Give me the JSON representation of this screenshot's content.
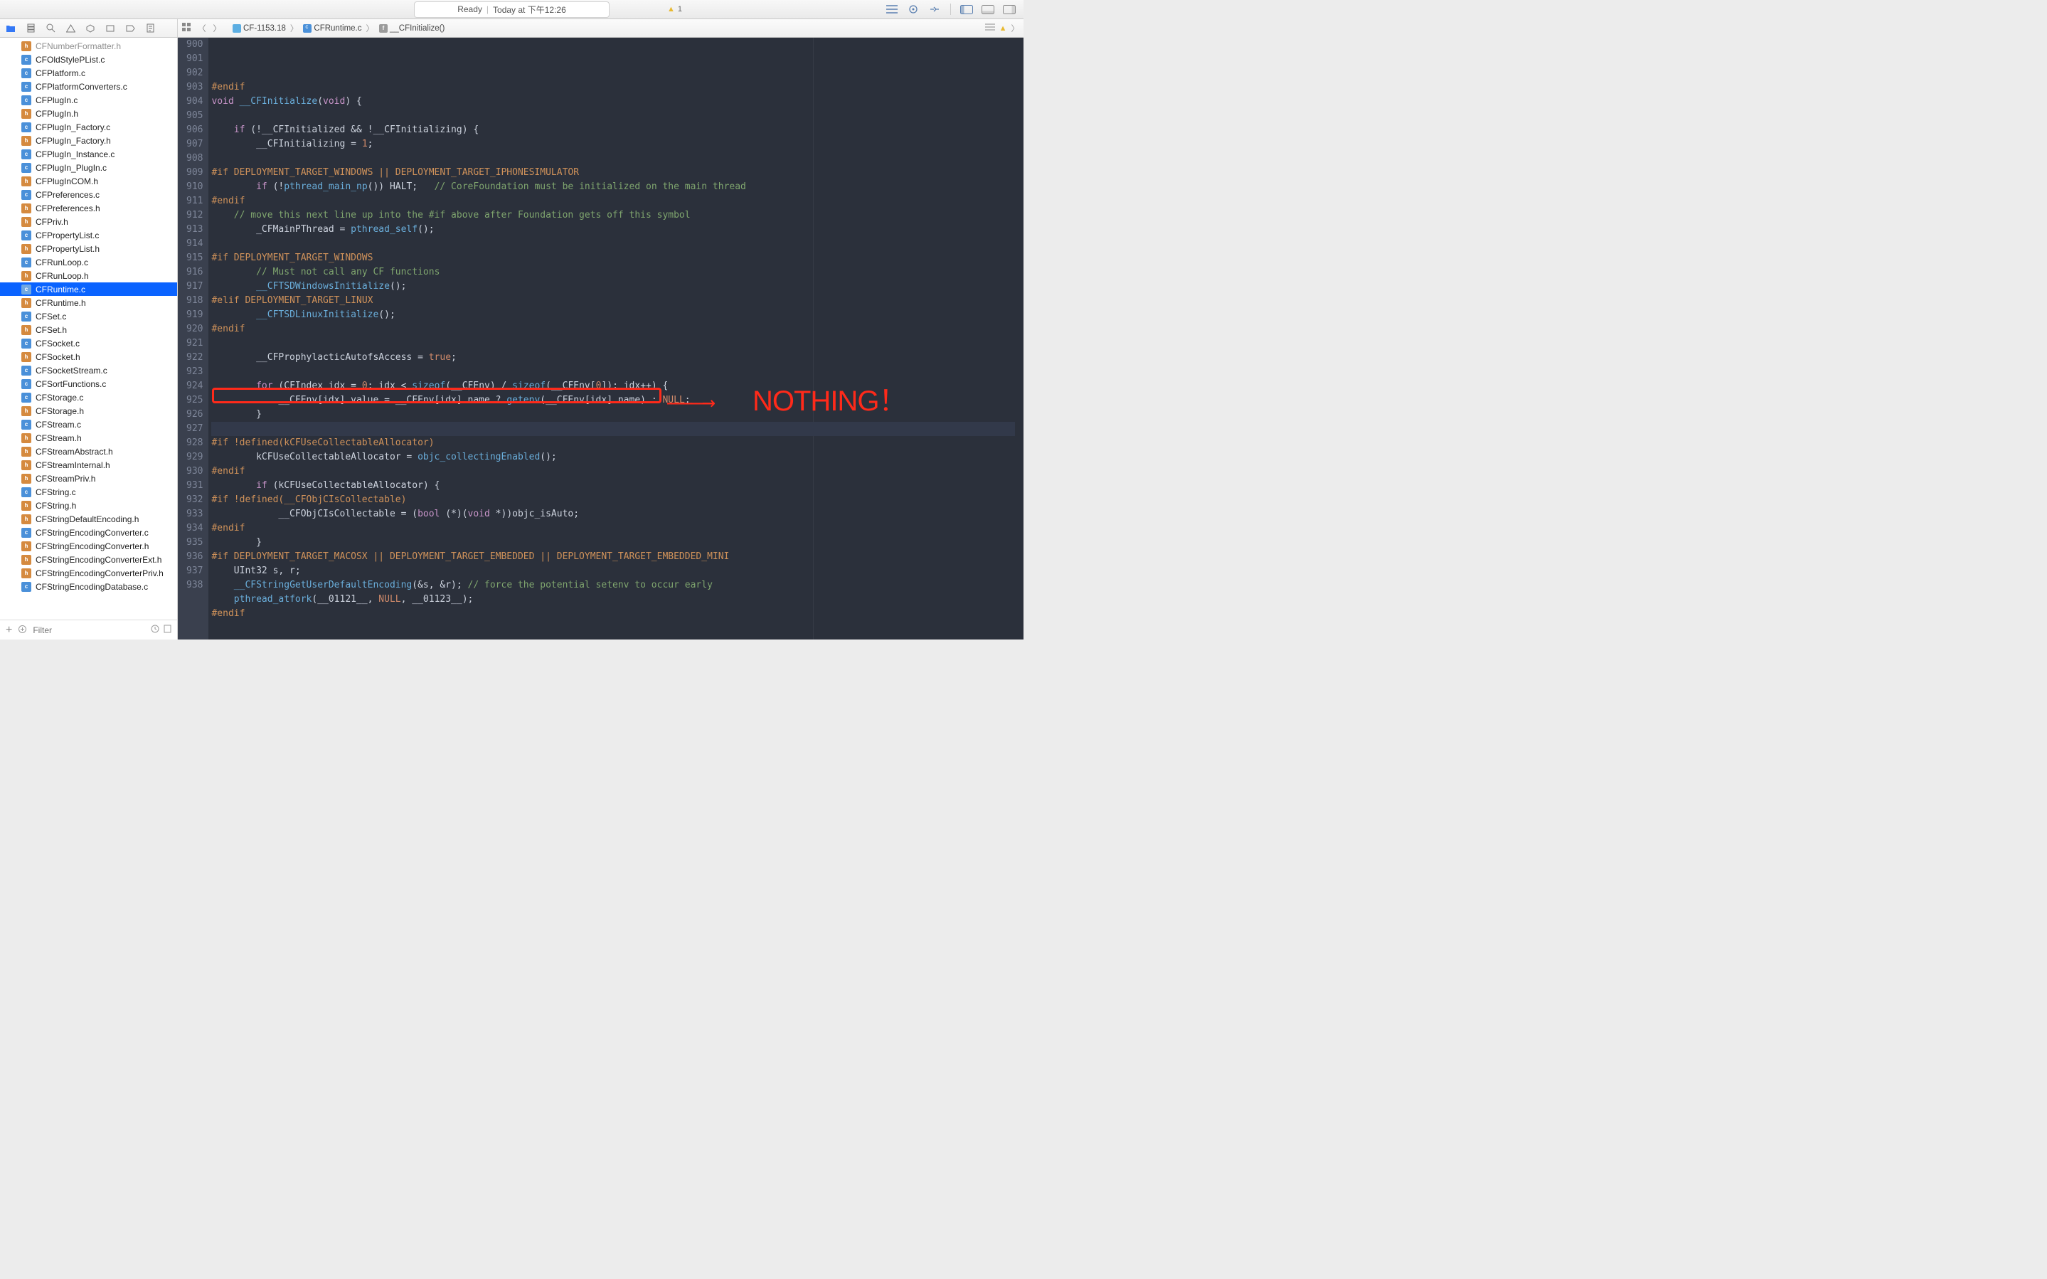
{
  "status_bar": {
    "status": "Ready",
    "timestamp": "Today at 下午12:26",
    "warning_count": "1"
  },
  "breadcrumb": {
    "project": "CF-1153.18",
    "file": "CFRuntime.c",
    "symbol": "__CFInitialize()"
  },
  "sidebar_filter_placeholder": "Filter",
  "files": [
    {
      "name": "CFNumberFormatter.h",
      "type": "h",
      "cut": true
    },
    {
      "name": "CFOldStylePList.c",
      "type": "c"
    },
    {
      "name": "CFPlatform.c",
      "type": "c"
    },
    {
      "name": "CFPlatformConverters.c",
      "type": "c"
    },
    {
      "name": "CFPlugIn.c",
      "type": "c"
    },
    {
      "name": "CFPlugIn.h",
      "type": "h"
    },
    {
      "name": "CFPlugIn_Factory.c",
      "type": "c"
    },
    {
      "name": "CFPlugIn_Factory.h",
      "type": "h"
    },
    {
      "name": "CFPlugIn_Instance.c",
      "type": "c"
    },
    {
      "name": "CFPlugIn_PlugIn.c",
      "type": "c"
    },
    {
      "name": "CFPlugInCOM.h",
      "type": "h"
    },
    {
      "name": "CFPreferences.c",
      "type": "c"
    },
    {
      "name": "CFPreferences.h",
      "type": "h"
    },
    {
      "name": "CFPriv.h",
      "type": "h"
    },
    {
      "name": "CFPropertyList.c",
      "type": "c"
    },
    {
      "name": "CFPropertyList.h",
      "type": "h"
    },
    {
      "name": "CFRunLoop.c",
      "type": "c"
    },
    {
      "name": "CFRunLoop.h",
      "type": "h"
    },
    {
      "name": "CFRuntime.c",
      "type": "c",
      "selected": true
    },
    {
      "name": "CFRuntime.h",
      "type": "h"
    },
    {
      "name": "CFSet.c",
      "type": "c"
    },
    {
      "name": "CFSet.h",
      "type": "h"
    },
    {
      "name": "CFSocket.c",
      "type": "c"
    },
    {
      "name": "CFSocket.h",
      "type": "h"
    },
    {
      "name": "CFSocketStream.c",
      "type": "c"
    },
    {
      "name": "CFSortFunctions.c",
      "type": "c"
    },
    {
      "name": "CFStorage.c",
      "type": "c"
    },
    {
      "name": "CFStorage.h",
      "type": "h"
    },
    {
      "name": "CFStream.c",
      "type": "c"
    },
    {
      "name": "CFStream.h",
      "type": "h"
    },
    {
      "name": "CFStreamAbstract.h",
      "type": "h"
    },
    {
      "name": "CFStreamInternal.h",
      "type": "h"
    },
    {
      "name": "CFStreamPriv.h",
      "type": "h"
    },
    {
      "name": "CFString.c",
      "type": "c"
    },
    {
      "name": "CFString.h",
      "type": "h"
    },
    {
      "name": "CFStringDefaultEncoding.h",
      "type": "h"
    },
    {
      "name": "CFStringEncodingConverter.c",
      "type": "c"
    },
    {
      "name": "CFStringEncodingConverter.h",
      "type": "h"
    },
    {
      "name": "CFStringEncodingConverterExt.h",
      "type": "h"
    },
    {
      "name": "CFStringEncodingConverterPriv.h",
      "type": "h"
    },
    {
      "name": "CFStringEncodingDatabase.c",
      "type": "c"
    }
  ],
  "annotation": {
    "arrow": "———→",
    "label": "NOTHING！"
  },
  "gutter_start": 900,
  "gutter_end": 938,
  "current_line": 924,
  "code_lines": [
    {
      "n": 900,
      "html": "<span class='pp'>#endif</span>"
    },
    {
      "n": 901,
      "html": "<span class='kw'>void</span> <span class='fn'>__CFInitialize</span>(<span class='kw'>void</span>) {"
    },
    {
      "n": 902,
      "html": ""
    },
    {
      "n": 903,
      "html": "    <span class='kw'>if</span> (!__CFInitialized &amp;&amp; !__CFInitializing) {"
    },
    {
      "n": 904,
      "html": "        __CFInitializing = <span class='num'>1</span>;"
    },
    {
      "n": 905,
      "html": ""
    },
    {
      "n": 906,
      "html": "<span class='pp'>#if</span> <span class='pparg'>DEPLOYMENT_TARGET_WINDOWS || DEPLOYMENT_TARGET_IPHONESIMULATOR</span>"
    },
    {
      "n": 907,
      "html": "        <span class='kw'>if</span> (!<span class='fn'>pthread_main_np</span>()) HALT;   <span class='cm'>// CoreFoundation must be initialized on the main thread</span>"
    },
    {
      "n": 908,
      "html": "<span class='pp'>#endif</span>"
    },
    {
      "n": 909,
      "html": "    <span class='cm'>// move this next line up into the #if above after Foundation gets off this symbol</span>"
    },
    {
      "n": 910,
      "html": "        _CFMainPThread = <span class='fn'>pthread_self</span>();"
    },
    {
      "n": 911,
      "html": ""
    },
    {
      "n": 912,
      "html": "<span class='pp'>#if</span> <span class='pparg'>DEPLOYMENT_TARGET_WINDOWS</span>"
    },
    {
      "n": 913,
      "html": "        <span class='cm'>// Must not call any CF functions</span>"
    },
    {
      "n": 914,
      "html": "        <span class='fn'>__CFTSDWindowsInitialize</span>();"
    },
    {
      "n": 915,
      "html": "<span class='pp'>#elif</span> <span class='pparg'>DEPLOYMENT_TARGET_LINUX</span>"
    },
    {
      "n": 916,
      "html": "        <span class='fn'>__CFTSDLinuxInitialize</span>();"
    },
    {
      "n": 917,
      "html": "<span class='pp'>#endif</span>"
    },
    {
      "n": 918,
      "html": ""
    },
    {
      "n": 919,
      "html": "        __CFProphylacticAutofsAccess = <span class='bool'>true</span>;"
    },
    {
      "n": 920,
      "html": ""
    },
    {
      "n": 921,
      "html": "        <span class='kw'>for</span> (CFIndex idx = <span class='num'>0</span>; idx &lt; <span class='sz'>sizeof</span>(__CFEnv) / <span class='sz'>sizeof</span>(__CFEnv[<span class='num'>0</span>]); idx++) {"
    },
    {
      "n": 922,
      "html": "            __CFEnv[idx].value = __CFEnv[idx].name ? <span class='fn'>getenv</span>(__CFEnv[idx].name) : <span class='null'>NULL</span>;"
    },
    {
      "n": 923,
      "html": "        }"
    },
    {
      "n": 924,
      "html": ""
    },
    {
      "n": 925,
      "html": "<span class='pp'>#if</span> <span class='pparg'>!defined(kCFUseCollectableAllocator)</span>"
    },
    {
      "n": 926,
      "html": "        kCFUseCollectableAllocator = <span class='fn'>objc_collectingEnabled</span>();"
    },
    {
      "n": 927,
      "html": "<span class='pp'>#endif</span>"
    },
    {
      "n": 928,
      "html": "        <span class='kw'>if</span> (kCFUseCollectableAllocator) {"
    },
    {
      "n": 929,
      "html": "<span class='pp'>#if</span> <span class='pparg'>!defined(__CFObjCIsCollectable)</span>"
    },
    {
      "n": 930,
      "html": "            __CFObjCIsCollectable = (<span class='kw'>bool</span> (*)(<span class='kw'>void</span> *))objc_isAuto;"
    },
    {
      "n": 931,
      "html": "<span class='pp'>#endif</span>"
    },
    {
      "n": 932,
      "html": "        }"
    },
    {
      "n": 933,
      "html": "<span class='pp'>#if</span> <span class='pparg'>DEPLOYMENT_TARGET_MACOSX || DEPLOYMENT_TARGET_EMBEDDED || DEPLOYMENT_TARGET_EMBEDDED_MINI</span>"
    },
    {
      "n": 934,
      "html": "    UInt32 s, r;"
    },
    {
      "n": 935,
      "html": "    <span class='fn'>__CFStringGetUserDefaultEncoding</span>(&amp;s, &amp;r); <span class='cm'>// force the potential setenv to occur early</span>"
    },
    {
      "n": 936,
      "html": "    <span class='fn'>pthread_atfork</span>(__01121__, <span class='null'>NULL</span>, __01123__);"
    },
    {
      "n": 937,
      "html": "<span class='pp'>#endif</span>"
    },
    {
      "n": 938,
      "html": ""
    }
  ]
}
